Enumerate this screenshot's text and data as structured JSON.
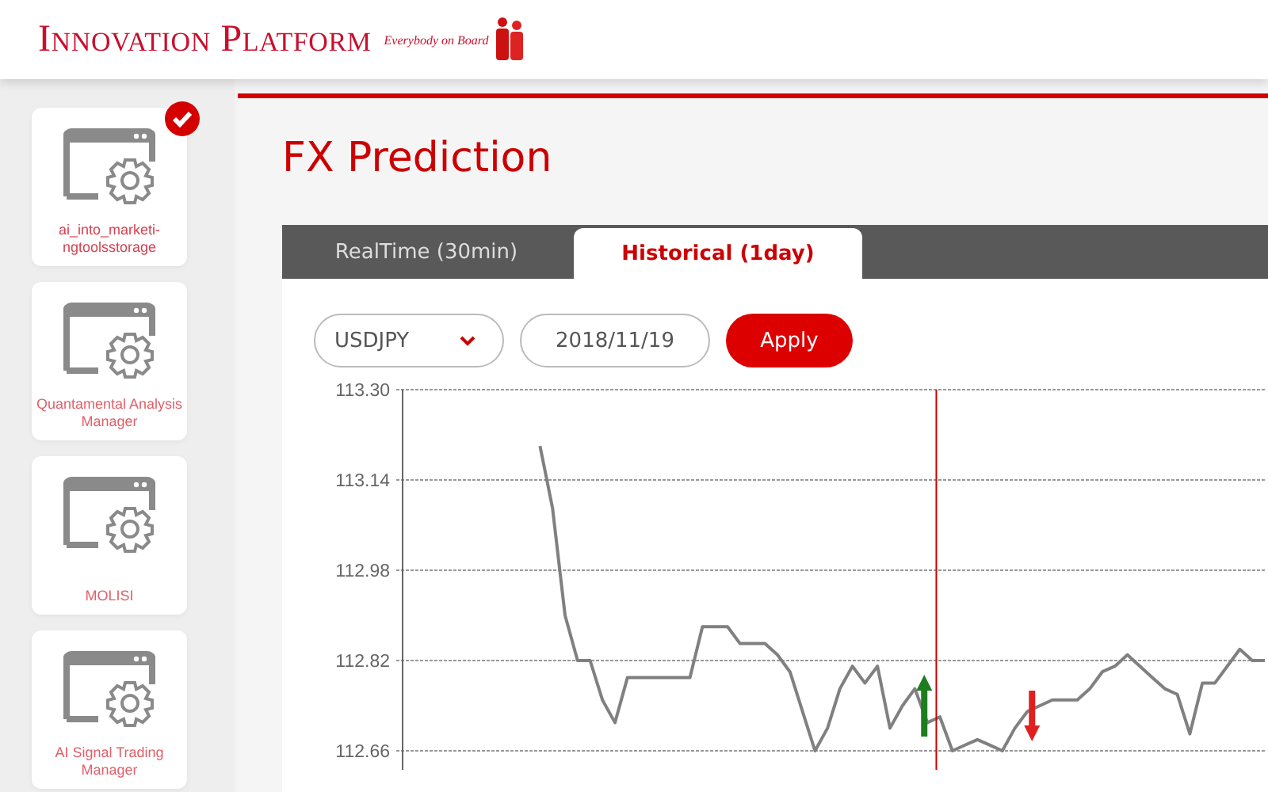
{
  "header": {
    "logo": "Innovation Platform",
    "tagline": "Everybody on Board"
  },
  "sidebar": {
    "items": [
      {
        "label": "ai_into_marketi-ngtoolsstorage",
        "selected": true
      },
      {
        "label": "Quantamental Analysis Manager",
        "selected": false
      },
      {
        "label": "MOLISI",
        "selected": false
      },
      {
        "label": "AI Signal Trading Manager",
        "selected": false
      }
    ]
  },
  "page": {
    "title": "FX Prediction"
  },
  "tabs": [
    {
      "label": "RealTime (30min)",
      "selected": false
    },
    {
      "label": "Historical (1day)",
      "selected": true
    }
  ],
  "controls": {
    "pair": "USDJPY",
    "date": "2018/11/19",
    "apply": "Apply"
  },
  "chart_data": {
    "type": "line",
    "grid": true,
    "ylim": [
      112.66,
      113.3
    ],
    "yticks": [
      {
        "value": 112.66,
        "label": "112.66"
      },
      {
        "value": 112.82,
        "label": "112.82"
      },
      {
        "value": 112.98,
        "label": "112.98"
      },
      {
        "value": 113.14,
        "label": "113.14"
      },
      {
        "value": 113.3,
        "label": "113.30"
      }
    ],
    "series": [
      {
        "color": "#808080",
        "values": [
          null,
          null,
          null,
          null,
          null,
          null,
          null,
          null,
          null,
          null,
          null,
          113.2,
          113.09,
          112.9,
          112.82,
          112.82,
          112.75,
          112.71,
          112.79,
          112.79,
          112.79,
          112.79,
          112.79,
          112.79,
          112.88,
          112.88,
          112.88,
          112.85,
          112.85,
          112.85,
          112.83,
          112.8,
          112.73,
          112.66,
          112.7,
          112.77,
          112.81,
          112.78,
          112.81,
          112.7,
          112.74,
          112.77,
          112.71,
          112.72,
          112.66,
          112.67,
          112.68,
          112.67,
          112.66,
          112.7,
          112.73,
          112.74,
          112.75,
          112.75,
          112.75,
          112.77,
          112.8,
          112.81,
          112.83,
          112.81,
          112.79,
          112.77,
          112.76,
          112.69,
          112.78,
          112.78,
          112.81,
          112.84,
          112.82,
          112.82
        ]
      }
    ]
  },
  "signals": [
    {
      "kind": "vline"
    },
    {
      "kind": "buy"
    },
    {
      "kind": "sell"
    }
  ]
}
